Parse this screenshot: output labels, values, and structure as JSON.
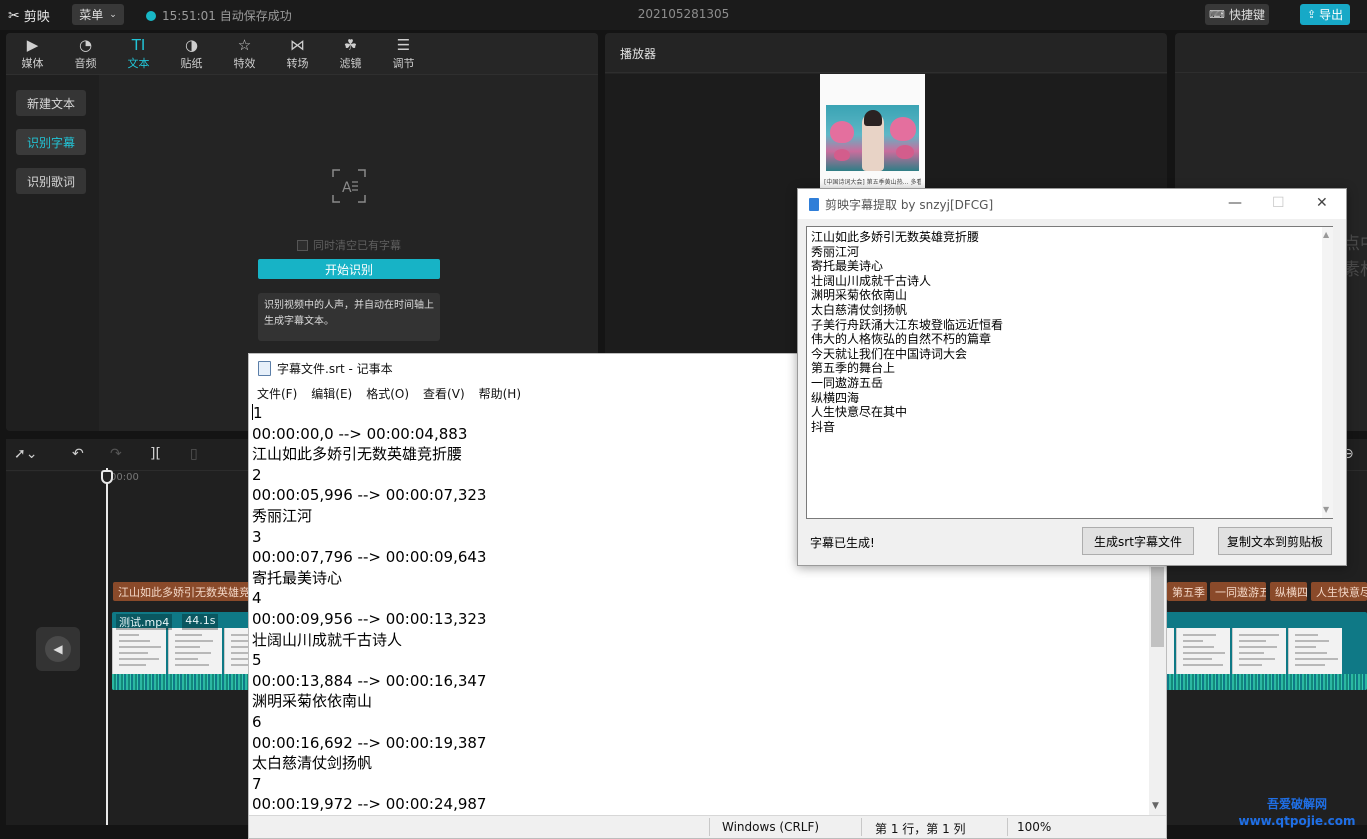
{
  "app": {
    "logo": "剪映",
    "menu_label": "菜单",
    "save_status": "15:51:01 自动保存成功",
    "project_title": "202105281305",
    "shortcut_label": "快捷键",
    "export_label": "导出",
    "accent_color": "#17a9c7"
  },
  "toolbar": {
    "tools": [
      {
        "label": "媒体",
        "icon": "media-icon"
      },
      {
        "label": "音频",
        "icon": "audio-icon"
      },
      {
        "label": "文本",
        "icon": "text-icon"
      },
      {
        "label": "贴纸",
        "icon": "sticker-icon"
      },
      {
        "label": "特效",
        "icon": "effect-icon"
      },
      {
        "label": "转场",
        "icon": "transition-icon"
      },
      {
        "label": "滤镜",
        "icon": "filter-icon"
      },
      {
        "label": "调节",
        "icon": "adjust-icon"
      }
    ],
    "active": "文本"
  },
  "text_nav": {
    "items": [
      "新建文本",
      "识别字幕",
      "识别歌词"
    ],
    "active": "识别字幕"
  },
  "recognize": {
    "clear_existing_label": "同时清空已有字幕",
    "start_label": "开始识别",
    "tip": "识别视频中的人声，并自动在时间轴上生成字幕文本。"
  },
  "player": {
    "title": "播放器",
    "caption": "[中国诗词大会] 第五季黄山热…  多看",
    "props_hint": "点中时\n素材"
  },
  "timeline": {
    "time_marker": "00:00",
    "subtitle_clips": [
      "江山如此多娇引无数英雄竞折腰",
      "第五季",
      "一同遨游五",
      "纵横四",
      "人生快意尽在"
    ],
    "video_clip_name": "测试.mp4",
    "video_clip_duration": "44.1s"
  },
  "notepad": {
    "title": "字幕文件.srt - 记事本",
    "menu": [
      "文件(F)",
      "编辑(E)",
      "格式(O)",
      "查看(V)",
      "帮助(H)"
    ],
    "lines": [
      "1",
      "00:00:00,0 --> 00:00:04,883",
      "江山如此多娇引无数英雄竞折腰",
      "2",
      "00:00:05,996 --> 00:00:07,323",
      "秀丽江河",
      "3",
      "00:00:07,796 --> 00:00:09,643",
      "寄托最美诗心",
      "4",
      "00:00:09,956 --> 00:00:13,323",
      "壮阔山川成就千古诗人",
      "5",
      "00:00:13,884 --> 00:00:16,347",
      "渊明采菊依依南山",
      "6",
      "00:00:16,692 --> 00:00:19,387",
      "太白慈清仗剑扬帆",
      "7",
      "00:00:19,972 --> 00:00:24,987"
    ],
    "status_encoding": "Windows (CRLF)",
    "status_position": "第 1 行，第 1 列",
    "status_zoom": "100%"
  },
  "extractor": {
    "title": "剪映字幕提取 by snzyj[DFCG]",
    "lines": [
      "江山如此多娇引无数英雄竞折腰",
      "秀丽江河",
      "寄托最美诗心",
      "壮阔山川成就千古诗人",
      "渊明采菊依依南山",
      "太白慈清仗剑扬帆",
      "子美行舟跃涌大江东坡登临远近恒看",
      "伟大的人格恢弘的自然不朽的篇章",
      "今天就让我们在中国诗词大会",
      "第五季的舞台上",
      "一同遨游五岳",
      "纵横四海",
      "人生快意尽在其中",
      "抖音"
    ],
    "status": "字幕已生成!",
    "generate_label": "生成srt字幕文件",
    "copy_label": "复制文本到剪贴板"
  },
  "watermark": {
    "line1": "吾爱破解网",
    "line2": "www.qtpojie.com"
  }
}
